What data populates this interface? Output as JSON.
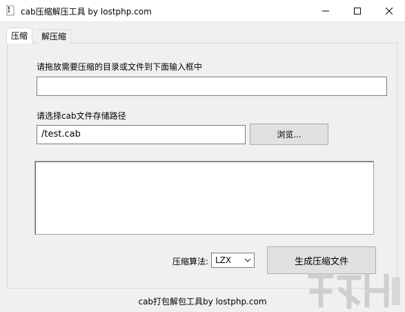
{
  "window": {
    "title": "cab压缩解压工具 by lostphp.com",
    "minimize_icon": "minimize-icon",
    "maximize_icon": "maximize-icon",
    "close_icon": "close-icon",
    "app_icon": "cab-file-icon"
  },
  "tabs": [
    {
      "label": "压缩",
      "active": true
    },
    {
      "label": "解压缩",
      "active": false
    }
  ],
  "compress": {
    "drop_label": "请拖放需要压缩的目录或文件到下面输入框中",
    "drop_value": "",
    "path_label": "请选择cab文件存储路径",
    "path_value": "/test.cab",
    "browse_label": "浏览...",
    "log_text": "",
    "algo_label": "压缩算法:",
    "algo_selected": "LZX",
    "generate_label": "生成压缩文件"
  },
  "footer": {
    "text": "cab打包解包工具by lostphp.com"
  },
  "colors": {
    "window_bg": "#f0f0f0",
    "titlebar_bg": "#ffffff",
    "button_bg": "#e1e1e1",
    "button_border": "#adadad",
    "watermark": "#c8c8c8"
  }
}
